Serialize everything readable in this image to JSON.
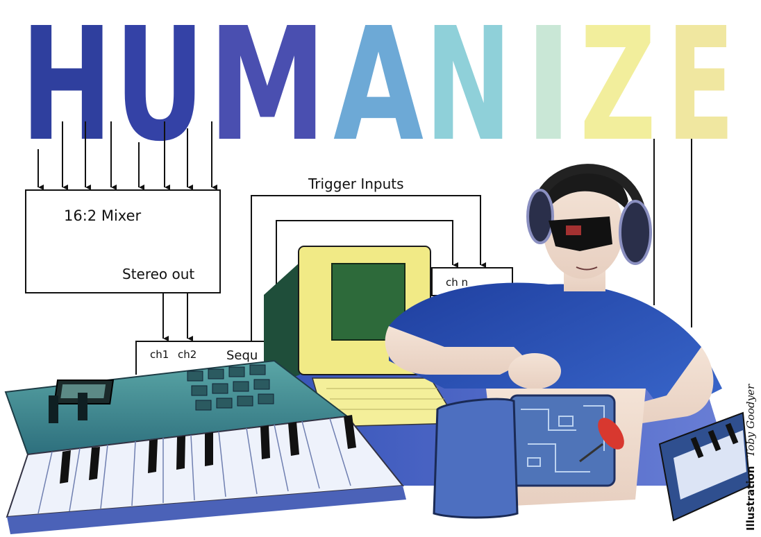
{
  "title": {
    "letters": [
      "H",
      "U",
      "M",
      "A",
      "N",
      "I",
      "Z",
      "E"
    ],
    "colors": [
      "#2f3f9e",
      "#3442a6",
      "#4a4fb0",
      "#6da9d6",
      "#8fd0d9",
      "#c9e7d6",
      "#f2ee9c",
      "#f0e7a0"
    ]
  },
  "diagram": {
    "mixer_label": "16:2 Mixer",
    "stereo_out_label": "Stereo out",
    "trigger_inputs_label": "Trigger Inputs",
    "ch_n_label": "ch n",
    "ch1_label": "ch1",
    "ch2_label": "ch2",
    "sequencer_label": "Sequ"
  },
  "credit": {
    "prefix": "Illustration",
    "name": "Toby Goodyer"
  },
  "colors": {
    "line": "#111111",
    "shirt": "#2c56b8",
    "keyboard": "#3f8f93",
    "monitor": "#f1ea86",
    "screen": "#2d6a3a",
    "desk": "#4a63c4"
  }
}
